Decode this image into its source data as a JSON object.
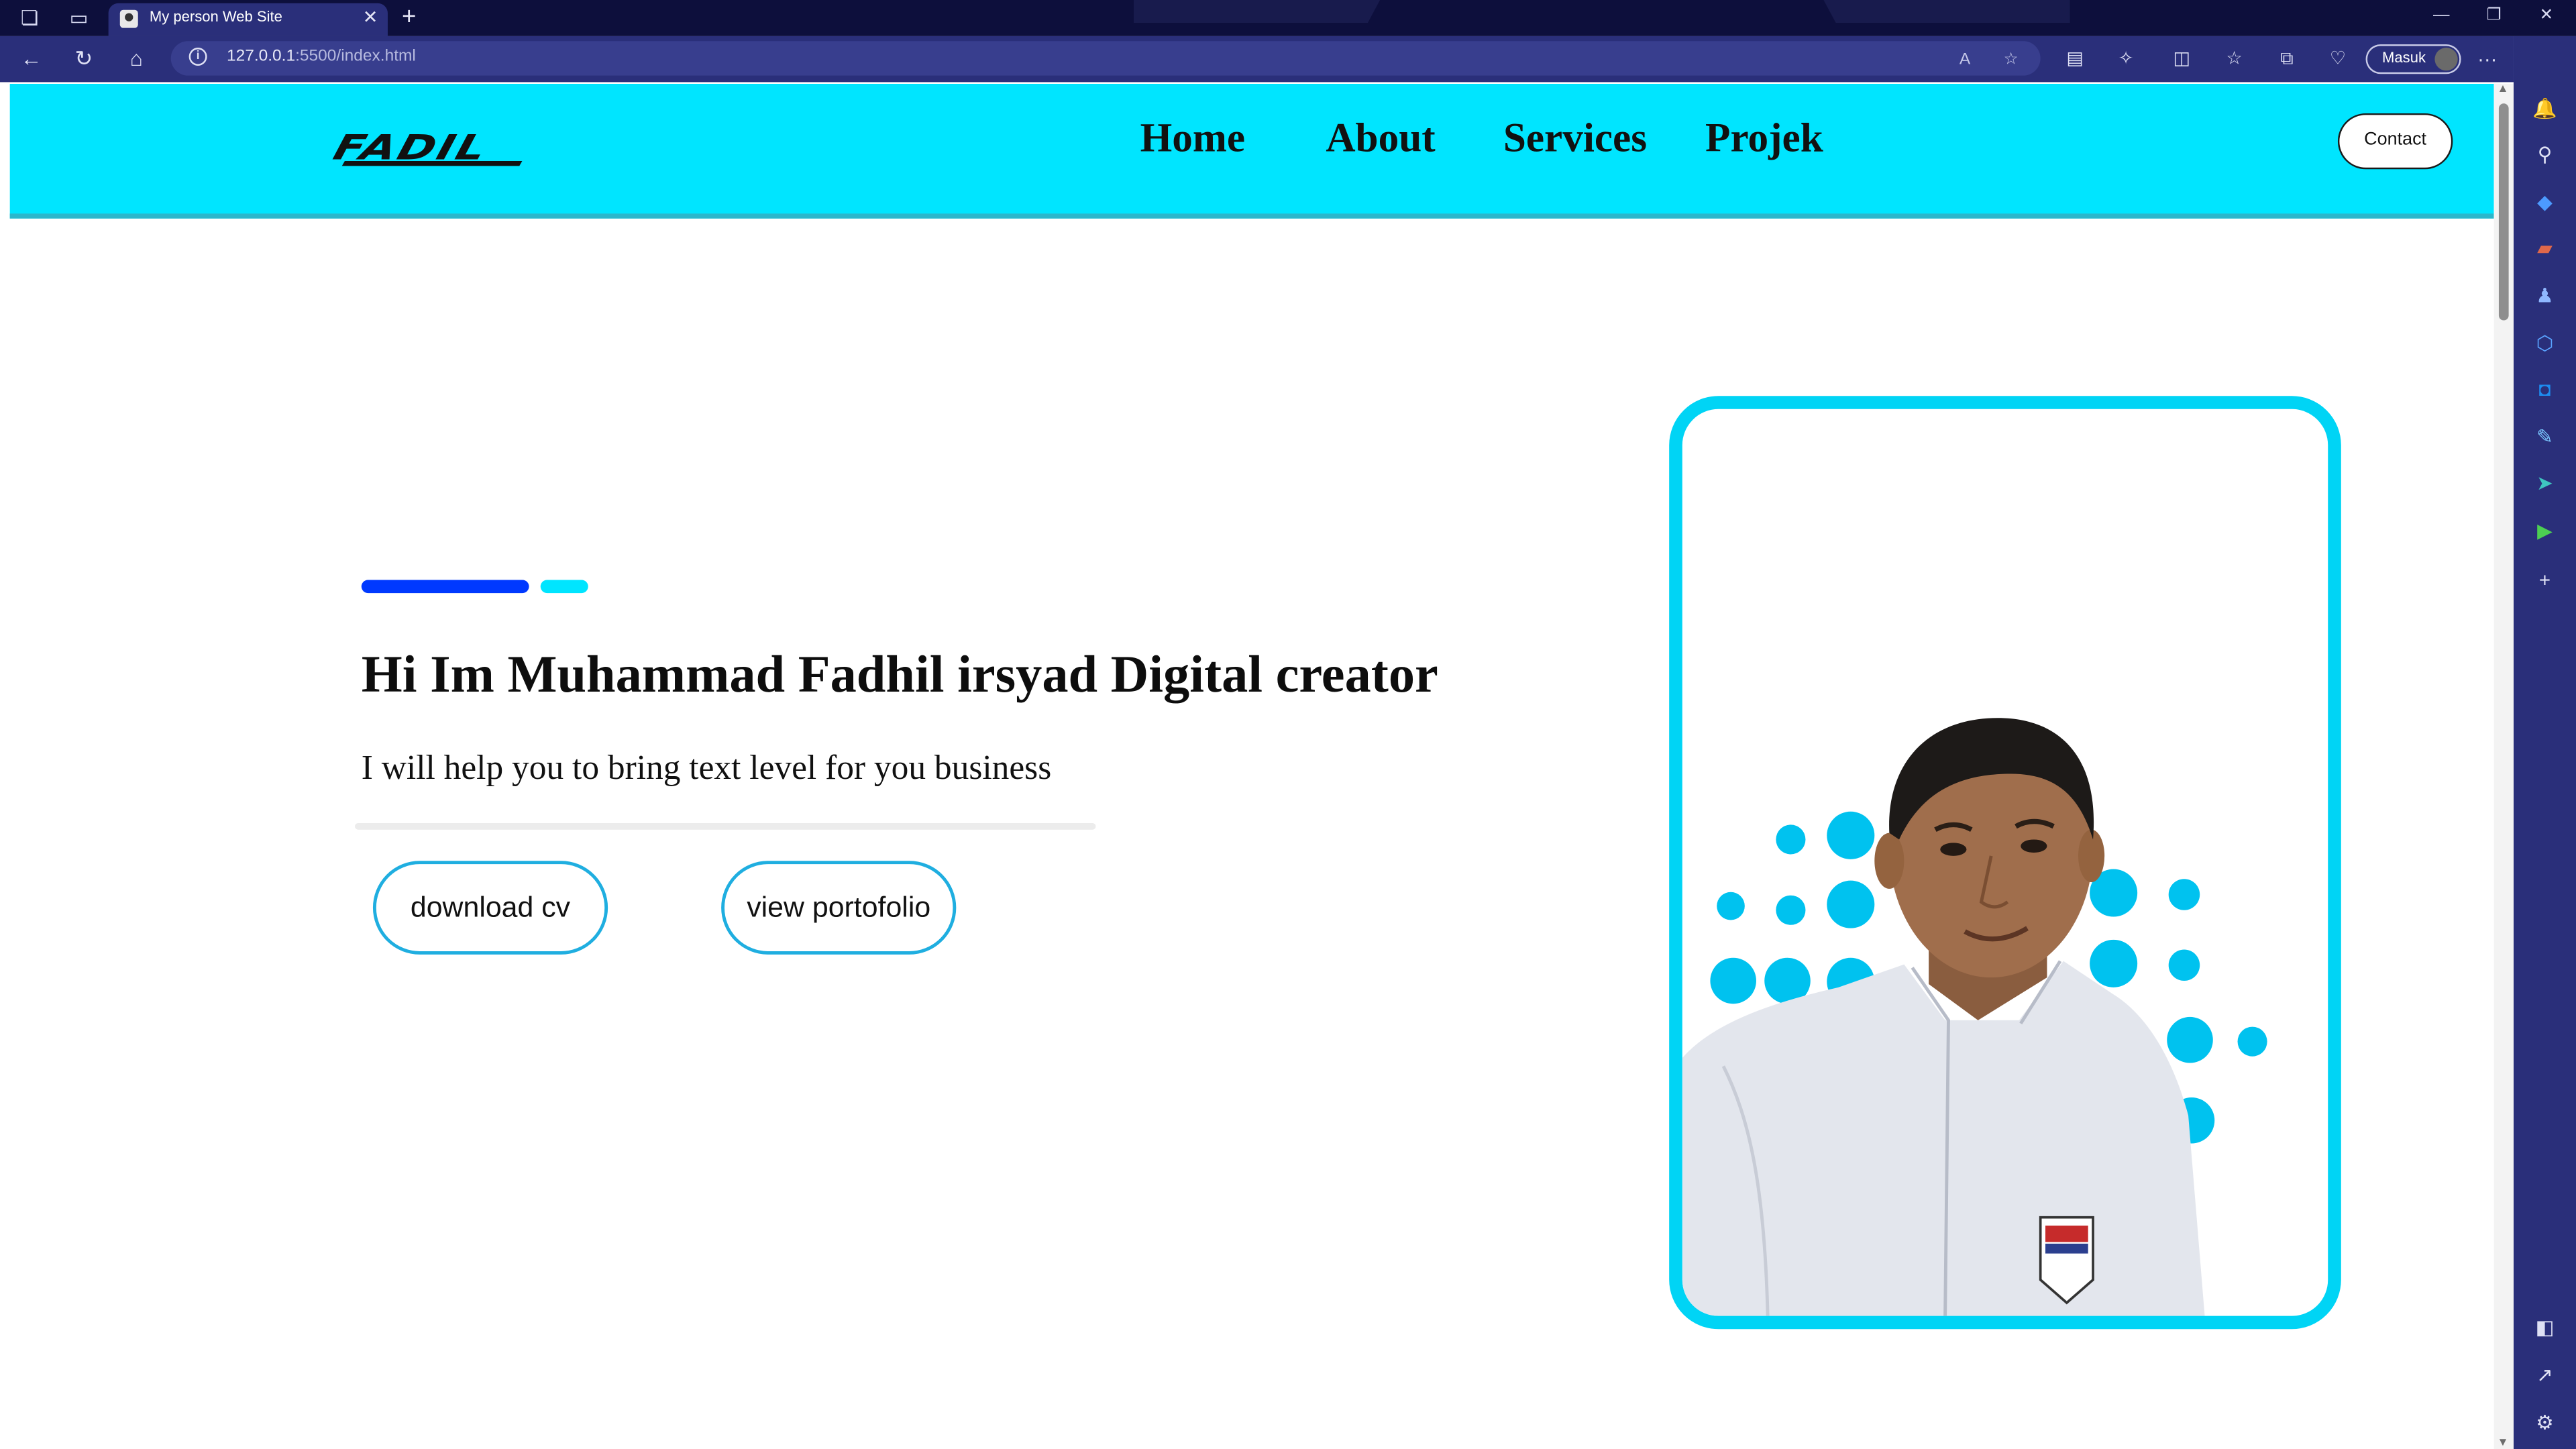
{
  "browser": {
    "tab_title": "My person Web Site",
    "tab_close": "✕",
    "new_tab": "+",
    "url_host": "127.0.0.1",
    "url_rest": ":5500/index.html",
    "profile_label": "Masuk",
    "window_controls": [
      "—",
      "❐",
      "✕"
    ]
  },
  "site": {
    "logo": "FADIL",
    "nav": [
      "Home",
      "About",
      "Services",
      "Projek"
    ],
    "contact_label": "Contact",
    "accent_color": "#00e5ff",
    "deco_color": "#0039ff"
  },
  "hero": {
    "title": "Hi Im Muhammad Fadhil irsyad Digital creator",
    "subtitle": "I will help you to bring text level for you business",
    "btn_cv": "download cv",
    "btn_portfolio": "view portofolio"
  }
}
